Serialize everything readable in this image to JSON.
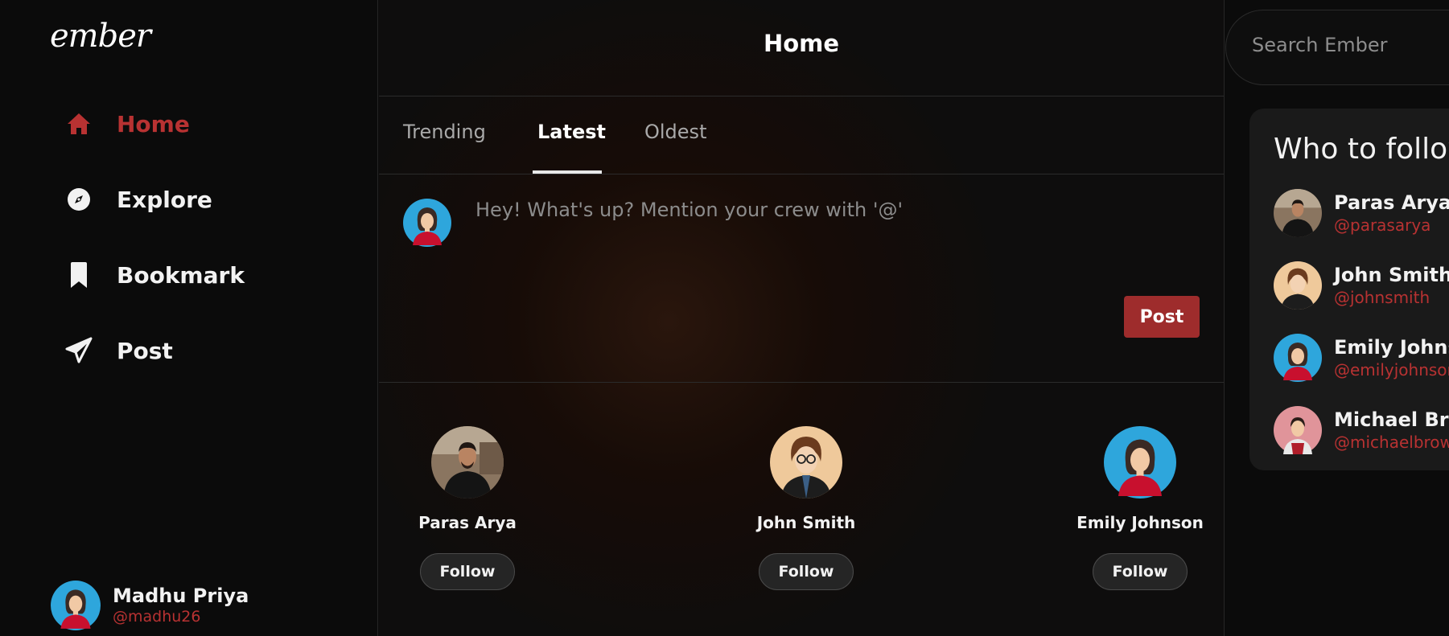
{
  "app": {
    "logo": "ember"
  },
  "sidebar": {
    "items": [
      {
        "label": "Home",
        "icon": "home-icon",
        "active": true
      },
      {
        "label": "Explore",
        "icon": "compass-icon",
        "active": false
      },
      {
        "label": "Bookmark",
        "icon": "bookmark-icon",
        "active": false
      },
      {
        "label": "Post",
        "icon": "send-icon",
        "active": false
      }
    ],
    "user": {
      "name": "Madhu Priya",
      "handle": "@madhu26"
    }
  },
  "main": {
    "title": "Home",
    "tabs": [
      {
        "label": "Trending",
        "active": false
      },
      {
        "label": "Latest",
        "active": true
      },
      {
        "label": "Oldest",
        "active": false
      }
    ],
    "composer": {
      "placeholder": "Hey! What's up? Mention your crew with '@'",
      "post_label": "Post"
    },
    "suggestions": [
      {
        "name": "Paras Arya",
        "follow_label": "Follow",
        "avatar": "photo"
      },
      {
        "name": "John Smith",
        "follow_label": "Follow",
        "avatar": "cartoon-man"
      },
      {
        "name": "Emily Johnson",
        "follow_label": "Follow",
        "avatar": "cartoon-woman"
      }
    ]
  },
  "right": {
    "search_placeholder": "Search Ember",
    "who_to_follow": {
      "title": "Who to follow",
      "users": [
        {
          "name": "Paras Arya",
          "handle": "@parasarya"
        },
        {
          "name": "John Smith",
          "handle": "@johnsmith"
        },
        {
          "name": "Emily Johnson",
          "handle": "@emilyjohnson"
        },
        {
          "name": "Michael Brown",
          "handle": "@michaelbrown"
        }
      ]
    }
  },
  "colors": {
    "accent": "#b83232",
    "post_button": "#9e2c2c",
    "background": "#0b0b0b"
  }
}
